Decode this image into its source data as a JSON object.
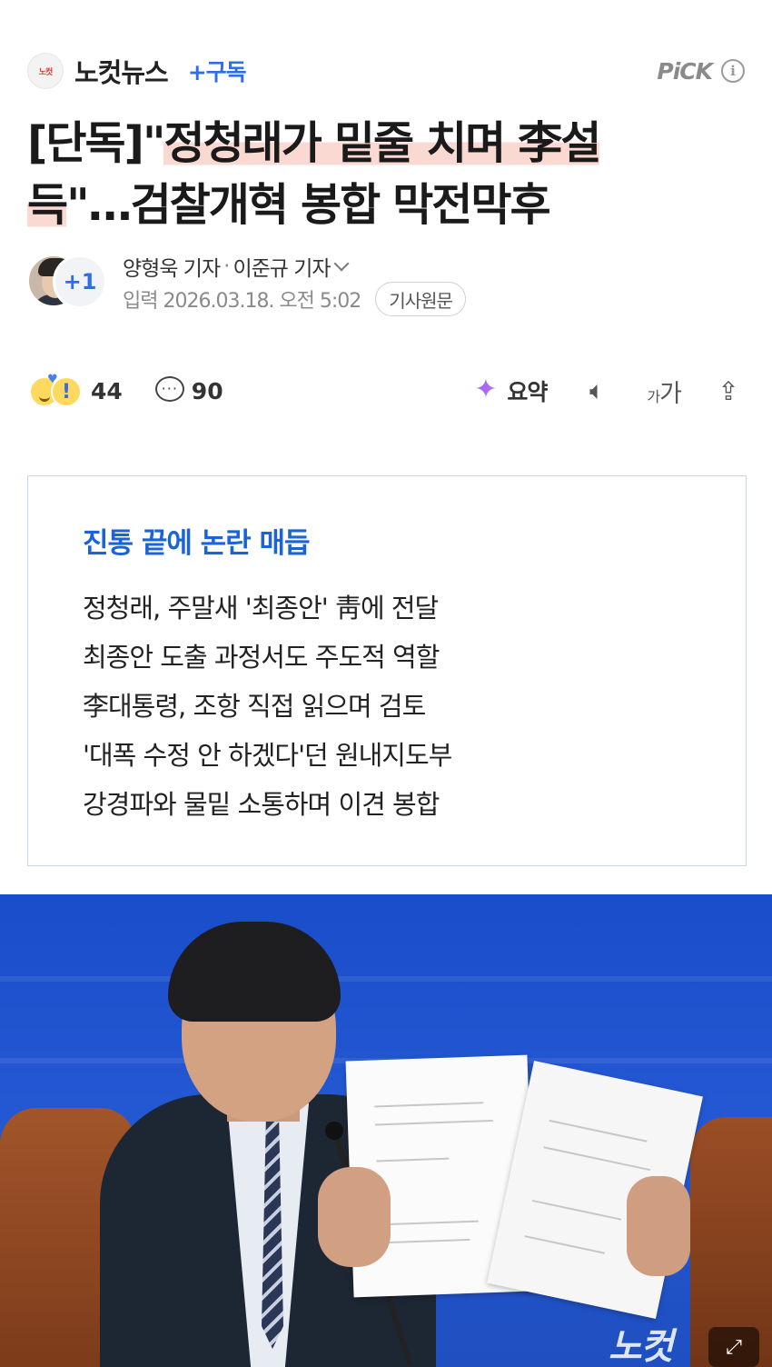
{
  "header": {
    "press_logo_text": "노컷",
    "press_name": "노컷뉴스",
    "subscribe_label": "+구독",
    "pick_label": "PiCK",
    "info_glyph": "i"
  },
  "headline": {
    "prefix": "[단독]\"",
    "highlight_1": "정청래가 밑줄 치며 李설",
    "highlight_2": "득",
    "suffix": "\"…검찰개혁 봉합 막전막후"
  },
  "byline": {
    "extra_reporters": "+1",
    "reporter_1": "양형욱 기자",
    "separator": "·",
    "reporter_2": "이준규 기자",
    "date": "입력 2026.03.18. 오전 5:02",
    "origin_button": "기사원문"
  },
  "actions": {
    "reaction_count": "44",
    "comment_count": "90",
    "summary_label": "요약",
    "font_small": "가",
    "font_big": "가",
    "colors": {
      "summary_gradient": [
        "#5c7cfa",
        "#b565f2",
        "#35c0f0"
      ]
    }
  },
  "summary_box": {
    "title": "진통 끝에 논란 매듭",
    "lines": [
      "정청래, 주말새 '최종안' 靑에 전달",
      "최종안 도출 과정서도 주도적 역할",
      "李대통령, 조항 직접 읽으며 검토",
      "'대폭 수정 안 하겠다'던 원내지도부",
      "강경파와 물밑 소통하며 이견 봉합"
    ],
    "colors": {
      "title": "#1b64d8",
      "border": "#c9d6e8"
    }
  },
  "photo": {
    "watermark": "노컷",
    "zoom_glyph": "⤢"
  },
  "colors": {
    "accent": "#2f6fe4",
    "highlight": "#fbd9d3"
  }
}
